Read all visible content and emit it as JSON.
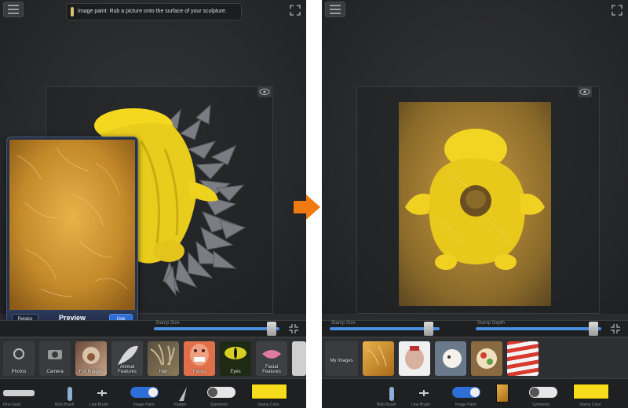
{
  "left": {
    "hint_text": "Image paint: Rub a picture onto the surface of your sculpture.",
    "preview": {
      "retake_label": "Retake",
      "title": "Preview",
      "use_label": "Use"
    },
    "slider_labels": [
      "Stamp Size",
      "Stamp Depth"
    ],
    "tray_tiles": [
      {
        "label": "Photos",
        "icon": "photos-icon"
      },
      {
        "label": "Camera",
        "icon": "camera-icon"
      },
      {
        "label": "Fur Images",
        "icon": "fur-image"
      },
      {
        "label": "Animal Features",
        "icon": "feather-image"
      },
      {
        "label": "Hair",
        "icon": "hair-image"
      },
      {
        "label": "Faces",
        "icon": "face-image"
      },
      {
        "label": "Eyes",
        "icon": "eye-image"
      },
      {
        "label": "Facial Features",
        "icon": "lips-image"
      }
    ]
  },
  "right": {
    "slider_labels": [
      "Stamp Size",
      "Stamp Depth"
    ],
    "tray_first_label": "My Images",
    "tray_tiles": [
      "fur-image",
      "face-image",
      "doll-image",
      "food-image",
      "stripes-image"
    ]
  },
  "toolbar": {
    "labels": [
      "Fine Grab",
      "Blob Brush",
      "Line Brush",
      "Image Paint",
      "Flatten",
      "Symmetry",
      "Stamp Color"
    ],
    "stamp_color": "#f6dc1a"
  },
  "colors": {
    "accent_blue": "#4a8ee0",
    "arrow_orange": "#f07a12",
    "panel_bg": "#2a2b2d"
  }
}
